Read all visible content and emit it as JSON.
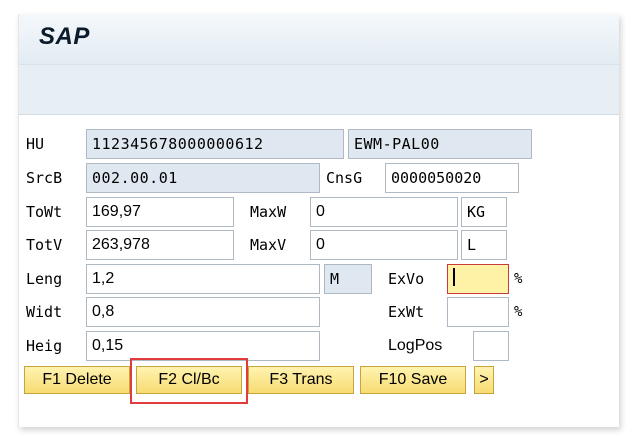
{
  "app": {
    "title": "SAP"
  },
  "form": {
    "hu": {
      "label": "HU",
      "value": "112345678000000612",
      "type_value": "EWM-PAL00"
    },
    "srcb": {
      "label": "SrcB",
      "value": "002.00.01"
    },
    "cnsg": {
      "label": "CnsG",
      "value": "0000050020"
    },
    "towt": {
      "label": "ToWt",
      "value": "169,97"
    },
    "maxw": {
      "label": "MaxW",
      "value": "0",
      "unit": "KG"
    },
    "totv": {
      "label": "TotV",
      "value": "263,978"
    },
    "maxv": {
      "label": "MaxV",
      "value": "0",
      "unit": "L"
    },
    "leng": {
      "label": "Leng",
      "value": "1,2",
      "unit": "M"
    },
    "exvo": {
      "label": "ExVo",
      "value": "",
      "suffix": "%"
    },
    "widt": {
      "label": "Widt",
      "value": "0,8"
    },
    "exwt": {
      "label": "ExWt",
      "value": "",
      "suffix": "%"
    },
    "heig": {
      "label": "Heig",
      "value": "0,15"
    },
    "logpos": {
      "label": "LogPos",
      "value": ""
    }
  },
  "buttons": {
    "delete": "F1 Delete",
    "clbc": "F2 Cl/Bc",
    "trans": "F3 Trans",
    "save": "F10 Save",
    "more": ">"
  }
}
